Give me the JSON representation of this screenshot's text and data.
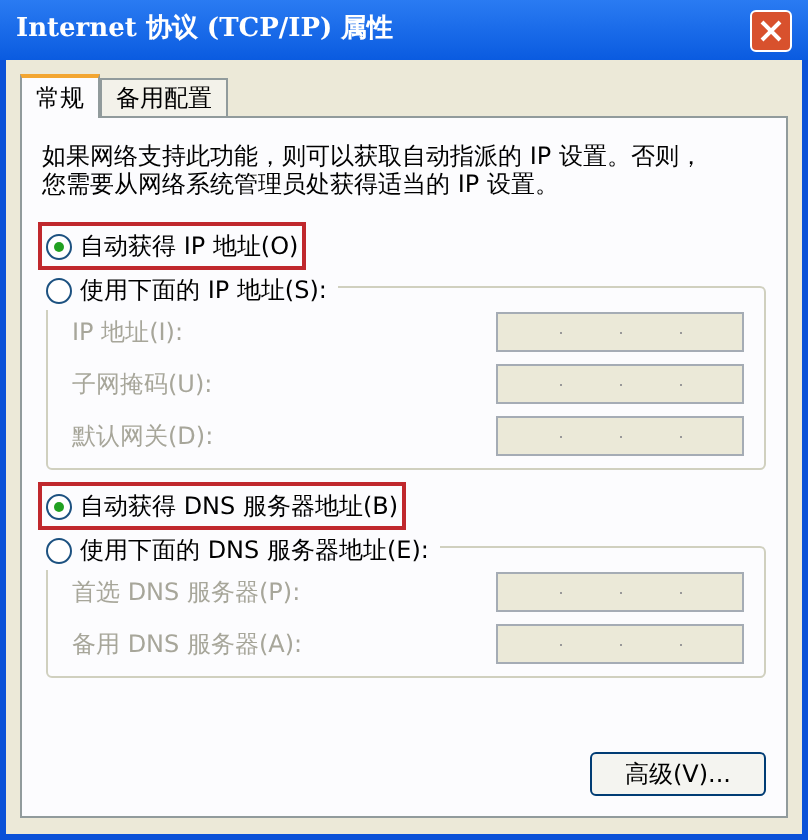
{
  "window": {
    "title": "Internet 协议 (TCP/IP) 属性"
  },
  "tabs": [
    {
      "label": "常规",
      "selected": true
    },
    {
      "label": "备用配置",
      "selected": false
    }
  ],
  "intro": "如果网络支持此功能，则可以获取自动指派的 IP 设置。否则，您需要从网络系统管理员处获得适当的 IP 设置。",
  "ip_group": {
    "options": [
      {
        "label": "自动获得 IP 地址(O)",
        "selected": true,
        "highlighted": true
      },
      {
        "label": "使用下面的 IP 地址(S):",
        "selected": false,
        "highlighted": false
      }
    ],
    "fields": [
      {
        "label": "IP 地址(I):",
        "disabled": true
      },
      {
        "label": "子网掩码(U):",
        "disabled": true
      },
      {
        "label": "默认网关(D):",
        "disabled": true
      }
    ]
  },
  "dns_group": {
    "options": [
      {
        "label": "自动获得 DNS 服务器地址(B)",
        "selected": true,
        "highlighted": true
      },
      {
        "label": "使用下面的 DNS 服务器地址(E):",
        "selected": false,
        "highlighted": false
      }
    ],
    "fields": [
      {
        "label": "首选 DNS 服务器(P):",
        "disabled": true
      },
      {
        "label": "备用 DNS 服务器(A):",
        "disabled": true
      }
    ]
  },
  "buttons": [
    "高级(V)..."
  ]
}
